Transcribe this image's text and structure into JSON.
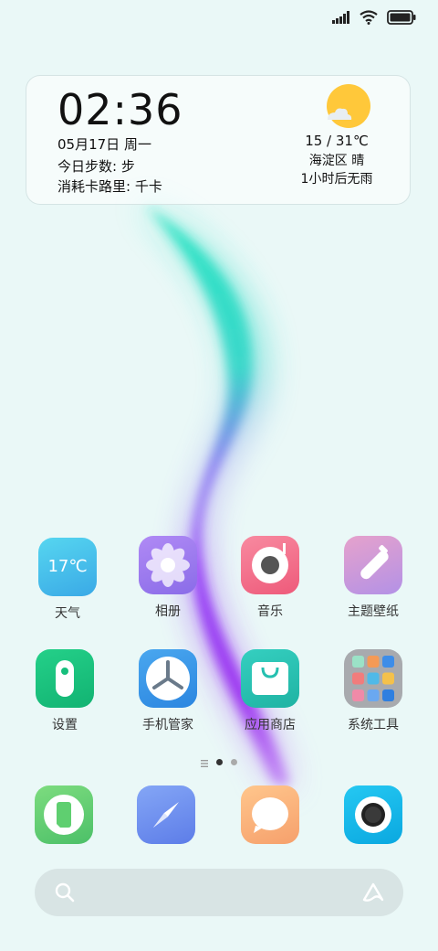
{
  "status_bar": {
    "icons": [
      "signal-icon",
      "wifi-icon",
      "battery-icon"
    ]
  },
  "widget": {
    "time": "02:36",
    "date": "05月17日 周一",
    "steps": "今日步数: 步",
    "calories": "消耗卡路里: 千卡",
    "weather": {
      "temp_range": "15 / 31℃",
      "location": "海淀区  晴",
      "forecast": "1小时后无雨",
      "icon": "sun-cloud-icon"
    }
  },
  "apps": [
    {
      "label": "天气",
      "tile_text": "17℃",
      "icon": "weather-app-icon"
    },
    {
      "label": "相册",
      "icon": "gallery-app-icon"
    },
    {
      "label": "音乐",
      "icon": "music-app-icon"
    },
    {
      "label": "主题壁纸",
      "icon": "themes-app-icon"
    },
    {
      "label": "设置",
      "icon": "settings-app-icon"
    },
    {
      "label": "手机管家",
      "icon": "security-app-icon"
    },
    {
      "label": "应用商店",
      "icon": "app-store-icon"
    },
    {
      "label": "系统工具",
      "icon": "system-tools-folder-icon"
    }
  ],
  "dock": [
    {
      "icon": "phone-app-icon"
    },
    {
      "icon": "browser-app-icon"
    },
    {
      "icon": "messages-app-icon"
    },
    {
      "icon": "camera-app-icon"
    }
  ],
  "page_indicator": {
    "pages": 2,
    "current": 1
  },
  "search": {
    "left_icon": "search-icon",
    "right_icon": "assistant-icon"
  },
  "colors": {
    "background": "#e9f7f6",
    "weather_tile": "#4ec9ea",
    "gallery_tile": "#9b7cf0",
    "music_tile": "#f06a86",
    "themes_tile": "#c79ad8",
    "settings_tile": "#17c07d",
    "security_tile": "#3a94e6",
    "store_tile": "#26c0b0",
    "tools_tile": "#a9a9a9",
    "phone_tile": "#5fcf70",
    "browser_tile": "#6f8ef2",
    "messages_tile": "#fbb07a",
    "camera_tile": "#11b8ea"
  }
}
